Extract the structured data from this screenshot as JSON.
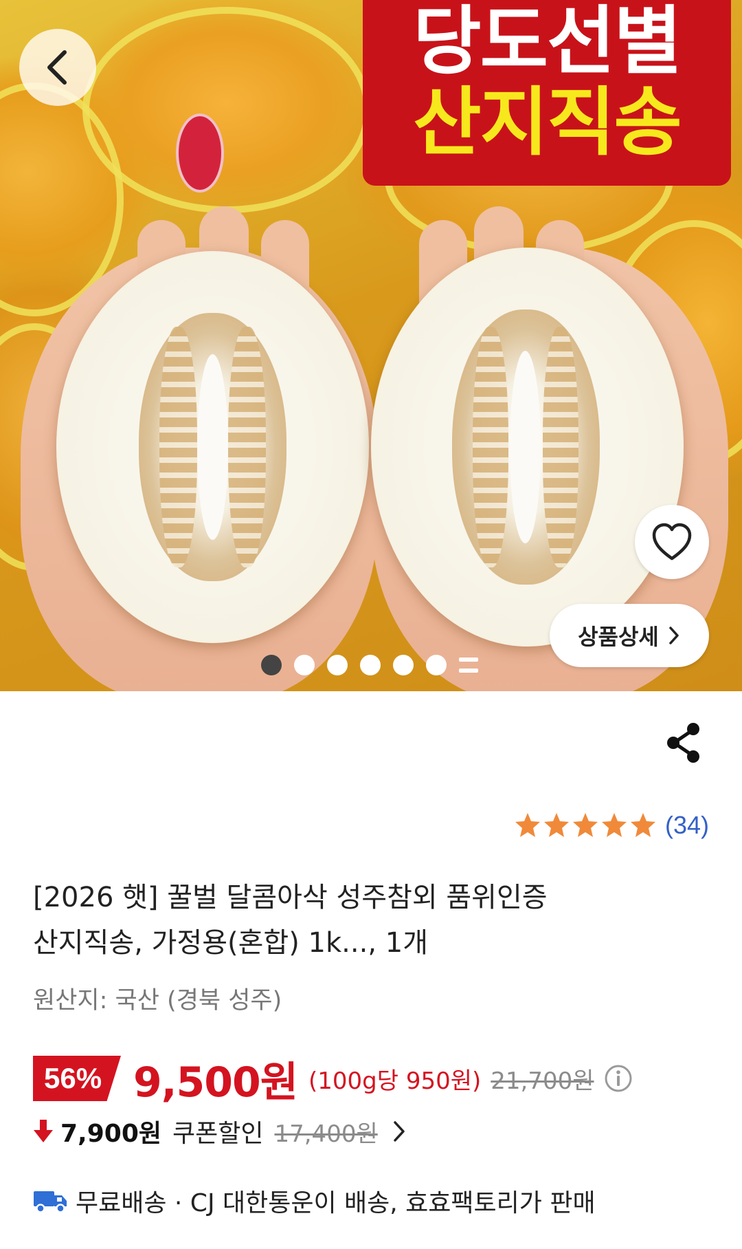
{
  "hero": {
    "promo_line1": "당도선별",
    "promo_line2": "산지직송",
    "detail_button_label": "상품상세",
    "slide_count": 6,
    "active_slide": 1
  },
  "rating": {
    "stars": 5,
    "review_count": "(34)",
    "star_color": "#f08a3a"
  },
  "product": {
    "title_line1": "[2026 햇] 꿀벌 달콤아삭 성주참외 품위인증",
    "title_line2": "산지직송, 가정용(혼합) 1k..., 1개",
    "origin": "원산지: 국산 (경북 성주)"
  },
  "price": {
    "discount": "56%",
    "sale_price": "9,500원",
    "unit_price": "(100g당 950원)",
    "original_price": "21,700원",
    "accent_color": "#d41320"
  },
  "coupon": {
    "price": "7,900원",
    "label": "쿠폰할인",
    "original_price": "17,400원"
  },
  "shipping": {
    "text": "무료배송 · CJ 대한통운이 배송, 효효팩토리가 판매",
    "icon_color": "#2f6fd6"
  },
  "icons": {
    "back": "chevron-left-icon",
    "wishlist": "heart-outline-icon",
    "share": "share-icon",
    "info": "info-circle-icon",
    "coupon_down": "arrow-down-icon",
    "shipping": "truck-icon"
  }
}
